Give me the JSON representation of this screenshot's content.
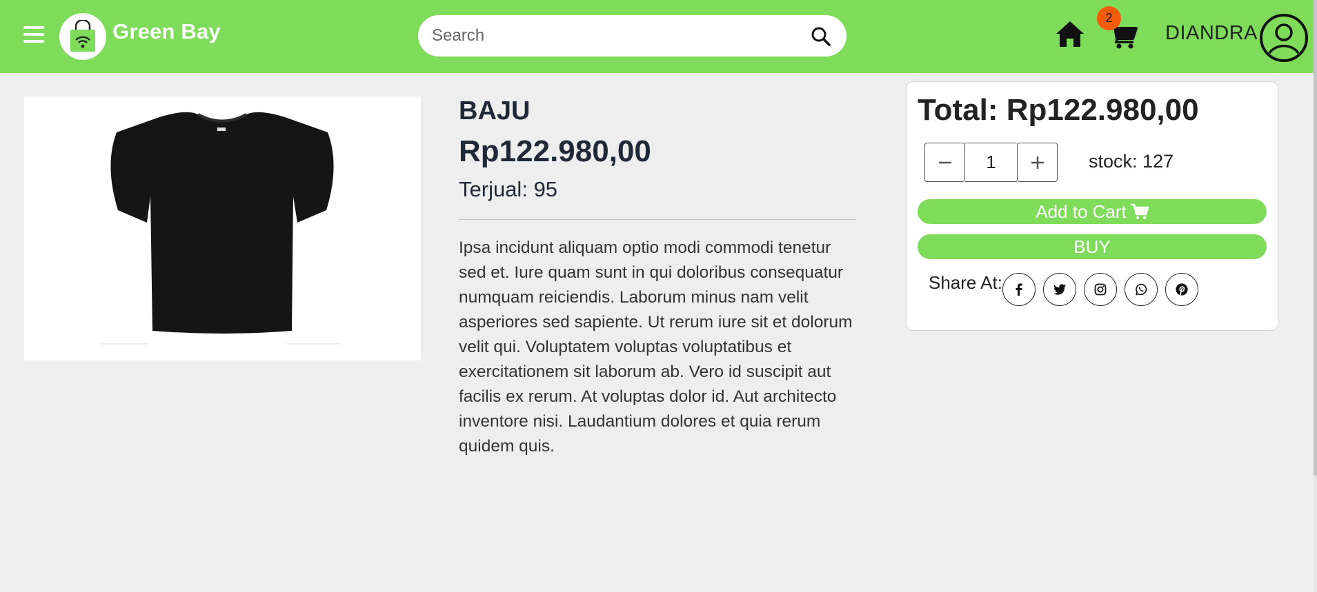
{
  "navbar": {
    "brand": "Green Bay",
    "search_placeholder": "Search",
    "cart_count": "2",
    "username": "DIANDRA",
    "icons": [
      "menu-icon",
      "bag-logo-icon",
      "search-icon",
      "home-icon",
      "cart-icon",
      "user-avatar-icon"
    ]
  },
  "product": {
    "name": "BAJU",
    "price": "Rp122.980,00",
    "sold_label": "Terjual:",
    "sold_value": "95",
    "description": "Ipsa incidunt aliquam optio modi commodi tenetur sed et. Iure quam sunt in qui doloribus consequatur numquam reiciendis. Laborum minus nam velit asperiores sed sapiente. Ut rerum iure sit et dolorum velit qui. Voluptatem voluptas voluptatibus et exercitationem sit laborum ab. Vero id suscipit aut facilis ex rerum. At voluptas dolor id. Aut architecto inventore nisi. Laudantium dolores et quia rerum quidem quis.",
    "image": "black-tshirt"
  },
  "order": {
    "total_label": "Total:",
    "total_value": "Rp122.980,00",
    "quantity": "1",
    "stock_label": "stock:",
    "stock_value": "127",
    "add_to_cart_label": "Add to Cart",
    "buy_label": "BUY",
    "share_label": "Share At:",
    "share_icons": [
      "facebook-icon",
      "twitter-icon",
      "instagram-icon",
      "whatsapp-icon",
      "pinterest-icon"
    ]
  },
  "colors": {
    "accent": "#7edc5a",
    "badge": "#f45b0a",
    "background": "#eeeeee"
  }
}
